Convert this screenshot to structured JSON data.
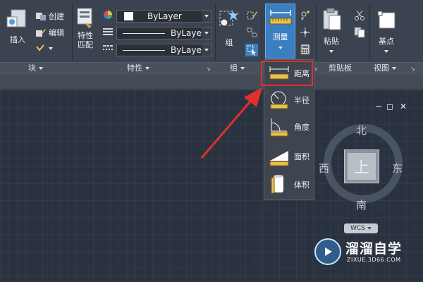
{
  "ribbon": {
    "block": {
      "insert_label": "插入",
      "create_label": "创建",
      "edit_label": "编辑",
      "panel_title": "块"
    },
    "properties": {
      "match_label_1": "特性",
      "match_label_2": "匹配",
      "layer_color": "ByLayer",
      "linetype": "ByLayer",
      "lineweight": "ByLayer",
      "panel_title": "特性"
    },
    "group": {
      "group_label": "组",
      "panel_title": "组"
    },
    "utilities": {
      "measure_label": "测量"
    },
    "clipboard": {
      "paste_label": "粘贴",
      "panel_title": "剪贴板"
    },
    "view": {
      "base_label": "基点",
      "panel_title": "视图"
    }
  },
  "measure_dropdown": {
    "items": [
      {
        "label": "距离",
        "icon": "distance-icon"
      },
      {
        "label": "半径",
        "icon": "radius-icon"
      },
      {
        "label": "角度",
        "icon": "angle-icon"
      },
      {
        "label": "面积",
        "icon": "area-icon"
      },
      {
        "label": "体积",
        "icon": "volume-icon"
      }
    ],
    "highlighted": "距离"
  },
  "viewcube": {
    "north": "北",
    "south": "南",
    "east": "东",
    "west": "西",
    "face": "上",
    "wcs_label": "WCS"
  },
  "window_controls": {
    "minimize": "−",
    "restore": "◻",
    "close": "✕"
  },
  "watermark": {
    "title": "溜溜自学",
    "subtitle": "ZIXUE.3D66.COM"
  },
  "colors": {
    "highlight_box": "#e0302a",
    "annotation_arrow": "#e0302a",
    "measure_active": "#3a7fc0"
  }
}
